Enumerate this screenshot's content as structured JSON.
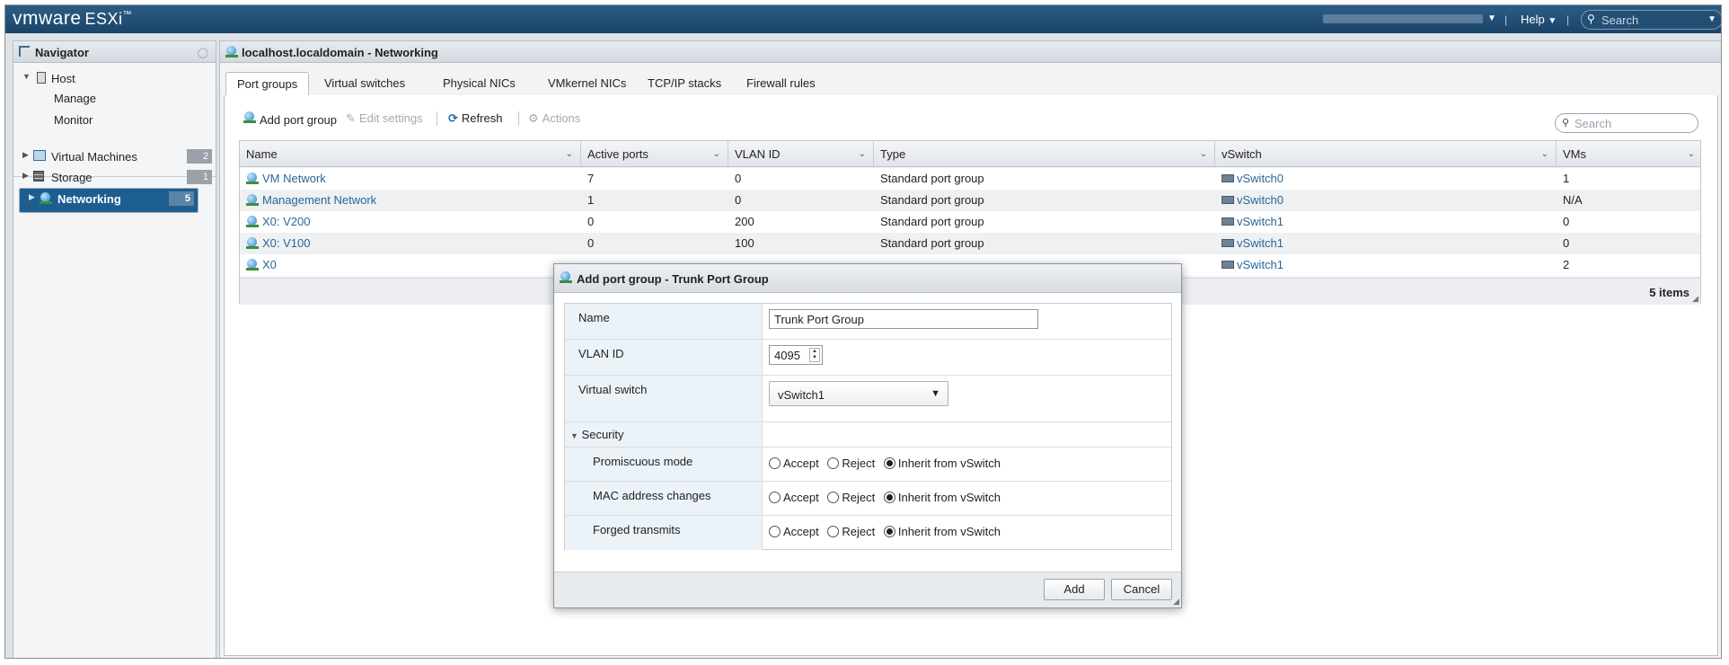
{
  "topbar": {
    "brand": "vmware",
    "product": "ESXi",
    "trademark": "™",
    "help_label": "Help",
    "search_placeholder": "Search"
  },
  "navigator": {
    "title": "Navigator",
    "host_label": "Host",
    "host_children": [
      "Manage",
      "Monitor"
    ],
    "items": [
      {
        "label": "Virtual Machines",
        "count": "2"
      },
      {
        "label": "Storage",
        "count": "1"
      },
      {
        "label": "Networking",
        "count": "5"
      }
    ]
  },
  "main": {
    "title": "localhost.localdomain - Networking",
    "tabs": [
      "Port groups",
      "Virtual switches",
      "Physical NICs",
      "VMkernel NICs",
      "TCP/IP stacks",
      "Firewall rules"
    ],
    "toolbar": {
      "add": "Add port group",
      "edit": "Edit settings",
      "refresh": "Refresh",
      "actions": "Actions",
      "search_placeholder": "Search"
    },
    "grid": {
      "columns": [
        "Name",
        "Active ports",
        "VLAN ID",
        "Type",
        "vSwitch",
        "VMs"
      ],
      "rows": [
        {
          "name": "VM Network",
          "active_ports": "7",
          "vlan_id": "0",
          "type": "Standard port group",
          "vswitch": "vSwitch0",
          "vms": "1"
        },
        {
          "name": "Management Network",
          "active_ports": "1",
          "vlan_id": "0",
          "type": "Standard port group",
          "vswitch": "vSwitch0",
          "vms": "N/A"
        },
        {
          "name": "X0: V200",
          "active_ports": "0",
          "vlan_id": "200",
          "type": "Standard port group",
          "vswitch": "vSwitch1",
          "vms": "0"
        },
        {
          "name": "X0: V100",
          "active_ports": "0",
          "vlan_id": "100",
          "type": "Standard port group",
          "vswitch": "vSwitch1",
          "vms": "0"
        },
        {
          "name": "X0",
          "active_ports": "",
          "vlan_id": "",
          "type": "",
          "vswitch": "vSwitch1",
          "vms": "2"
        }
      ],
      "footer_count": "5 items"
    }
  },
  "dialog": {
    "title": "Add port group - Trunk Port Group",
    "fields": {
      "name_label": "Name",
      "name_value": "Trunk Port Group",
      "vlan_label": "VLAN ID",
      "vlan_value": "4095",
      "vswitch_label": "Virtual switch",
      "vswitch_value": "vSwitch1"
    },
    "security": {
      "label": "Security",
      "rows": [
        {
          "label": "Promiscuous mode",
          "selected": "Inherit from vSwitch"
        },
        {
          "label": "MAC address changes",
          "selected": "Inherit from vSwitch"
        },
        {
          "label": "Forged transmits",
          "selected": "Inherit from vSwitch"
        }
      ],
      "options": [
        "Accept",
        "Reject",
        "Inherit from vSwitch"
      ]
    },
    "buttons": {
      "add": "Add",
      "cancel": "Cancel"
    }
  }
}
